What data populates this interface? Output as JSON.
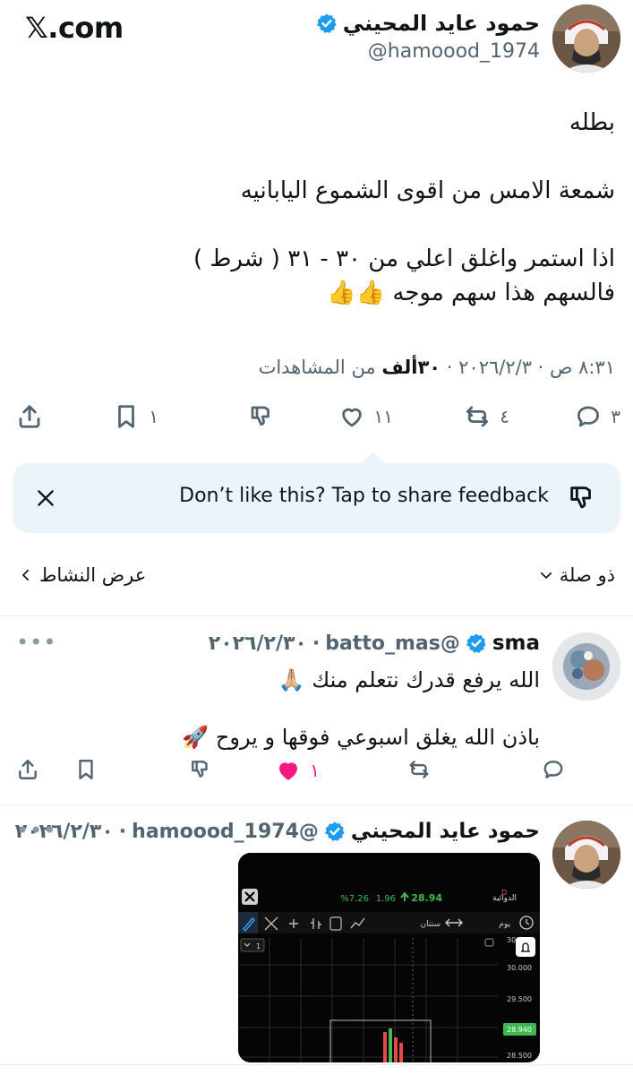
{
  "brand": {
    "label": "𝕏.com"
  },
  "main_post": {
    "author_name": "حمود عايد المحيني",
    "handle": "@hamoood_1974",
    "lines": [
      "بطله",
      "",
      "شمعة الامس من اقوى الشموع اليابانيه",
      "",
      "اذا استمر واغلق اعلي من ٣٠ - ٣١ ( شرط )",
      "فالسهم هذا سهم موجه 👍👍"
    ],
    "timestamp": "٨:٣١ ص · ٢٠٢٦/٢/٣",
    "views_count": "٣٠ألف",
    "views_label": "من المشاهدات",
    "actions": {
      "replies": "٣",
      "reposts": "٤",
      "likes": "١١",
      "bookmarks": "١"
    }
  },
  "feedback": {
    "text": "Don’t like this? Tap to share feedback"
  },
  "filter_bar": {
    "relevance": "ذو صلة",
    "view_activity": "عرض النشاط"
  },
  "reply1": {
    "author_name": "sma",
    "handle": "@batto_mas",
    "date": "٢٠٢٦/٢/٣٠",
    "line1": "الله يرفع قدرك نتعلم منك 🙏🏼",
    "line2": "باذن الله يغلق اسبوعي فوقها و يروح 🚀",
    "likes": "١"
  },
  "reply2": {
    "author_name": "حمود عايد المحيني",
    "handle": "@hamoood_1974",
    "date": "٢٠٢٦/٢/٣٠"
  },
  "chart_image": {
    "title": "الدوائية",
    "title_flag": "D",
    "price": "28.94",
    "change": "1.96",
    "change_pct": "%7.26",
    "period_label": "سنتان",
    "interval_label": "يوم",
    "interval_select": "1",
    "y_ticks": [
      "30",
      "30.000",
      "29.500",
      "28.940",
      "28.500"
    ],
    "colors": {
      "up": "#3fb950",
      "down": "#e5484d",
      "badge": "#3fb950"
    }
  },
  "colors": {
    "accent": "#1d9bf0",
    "like": "#f91880",
    "muted": "#536471"
  }
}
